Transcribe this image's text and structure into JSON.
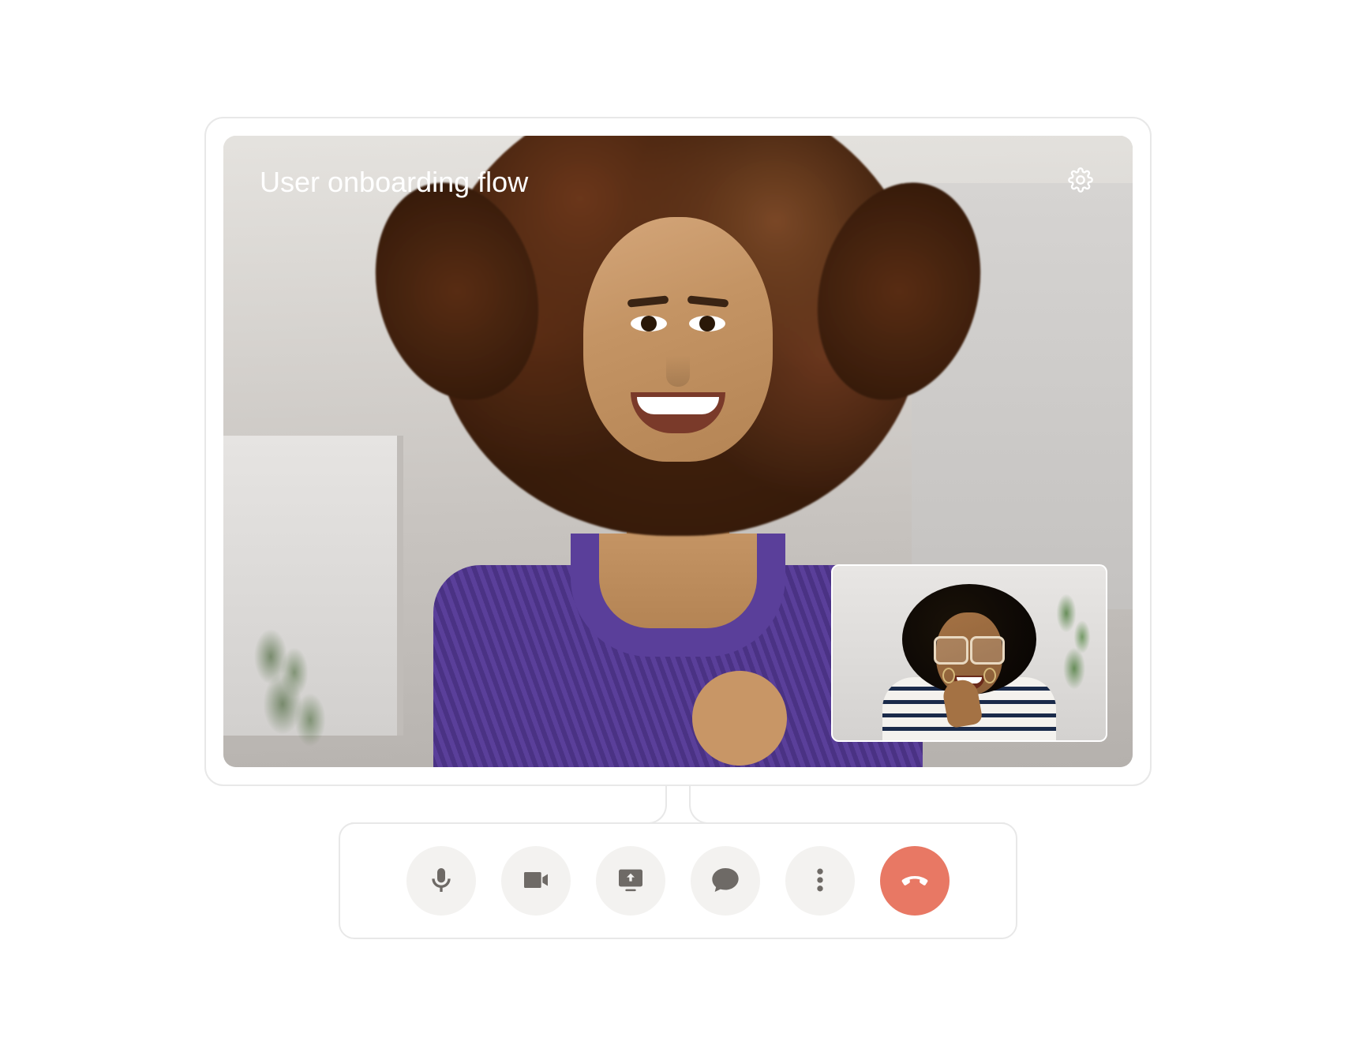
{
  "call": {
    "title": "User onboarding flow"
  },
  "icons": {
    "settings": "gear-icon",
    "mic": "microphone-icon",
    "camera": "video-camera-icon",
    "share": "screen-share-icon",
    "chat": "chat-icon",
    "more": "more-options-icon",
    "hangup": "hang-up-icon"
  },
  "colors": {
    "border": "#e8e8e8",
    "toolButtonBg": "#f3f2f0",
    "iconColor": "#6e6a66",
    "hangupBg": "#e87864"
  }
}
